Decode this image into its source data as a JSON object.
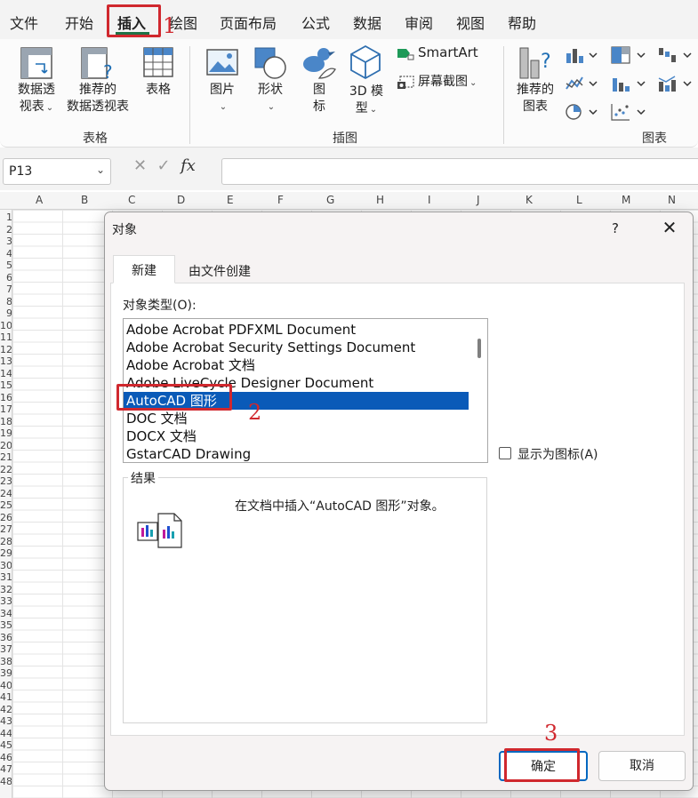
{
  "menu": {
    "items": [
      "文件",
      "开始",
      "插入",
      "绘图",
      "页面布局",
      "公式",
      "数据",
      "审阅",
      "视图",
      "帮助"
    ]
  },
  "ribbon": {
    "tables_group": {
      "label": "表格",
      "pivot_line1": "数据透",
      "pivot_line2": "视表",
      "recommended_line1": "推荐的",
      "recommended_line2": "数据透视表",
      "table": "表格"
    },
    "illustrations_group": {
      "label": "插图",
      "pictures": "图片",
      "shapes": "形状",
      "icons_line1": "图",
      "icons_line2": "标",
      "model3d_line1": "3D 模",
      "model3d_line2": "型",
      "smartart": "SmartArt",
      "screenshot": "屏幕截图"
    },
    "charts_group": {
      "label": "图表",
      "recommended_line1": "推荐的",
      "recommended_line2": "图表"
    }
  },
  "formula_bar": {
    "name_box": "P13",
    "fx": "fx"
  },
  "sheet": {
    "columns": [
      "A",
      "B",
      "C",
      "D",
      "E",
      "F",
      "G",
      "H",
      "I",
      "J",
      "K",
      "L",
      "M",
      "N"
    ],
    "rows": [
      "1",
      "2",
      "3",
      "4",
      "5",
      "6",
      "7",
      "8",
      "9",
      "10",
      "11",
      "12",
      "13",
      "14",
      "15",
      "16",
      "17",
      "18",
      "19",
      "20",
      "21",
      "22",
      "23",
      "24",
      "25",
      "26",
      "27",
      "28",
      "29",
      "30",
      "31",
      "32",
      "33",
      "34",
      "35",
      "36",
      "37",
      "38",
      "39",
      "40",
      "41",
      "42",
      "43",
      "44",
      "45",
      "46",
      "47",
      "48"
    ]
  },
  "dialog": {
    "title": "对象",
    "help": "?",
    "close": "✕",
    "tab_new": "新建",
    "tab_from_file": "由文件创建",
    "object_type_label": "对象类型(O):",
    "object_types": [
      "Adobe Acrobat PDFXML Document",
      "Adobe Acrobat Security Settings Document",
      "Adobe Acrobat 文档",
      "Adobe LiveCycle Designer Document",
      "AutoCAD 图形",
      "DOC 文档",
      "DOCX 文档",
      "GstarCAD Drawing"
    ],
    "selected_index": 4,
    "display_as_icon": "显示为图标(A)",
    "result_label": "结果",
    "result_text": "在文档中插入“AutoCAD 图形”对象。",
    "ok": "确定",
    "cancel": "取消"
  },
  "annotations": {
    "step1": "1",
    "step2": "2",
    "step3": "3"
  },
  "colors": {
    "highlight": "#d0282e",
    "selection": "#0a5ab8",
    "accent": "#0067c0"
  }
}
